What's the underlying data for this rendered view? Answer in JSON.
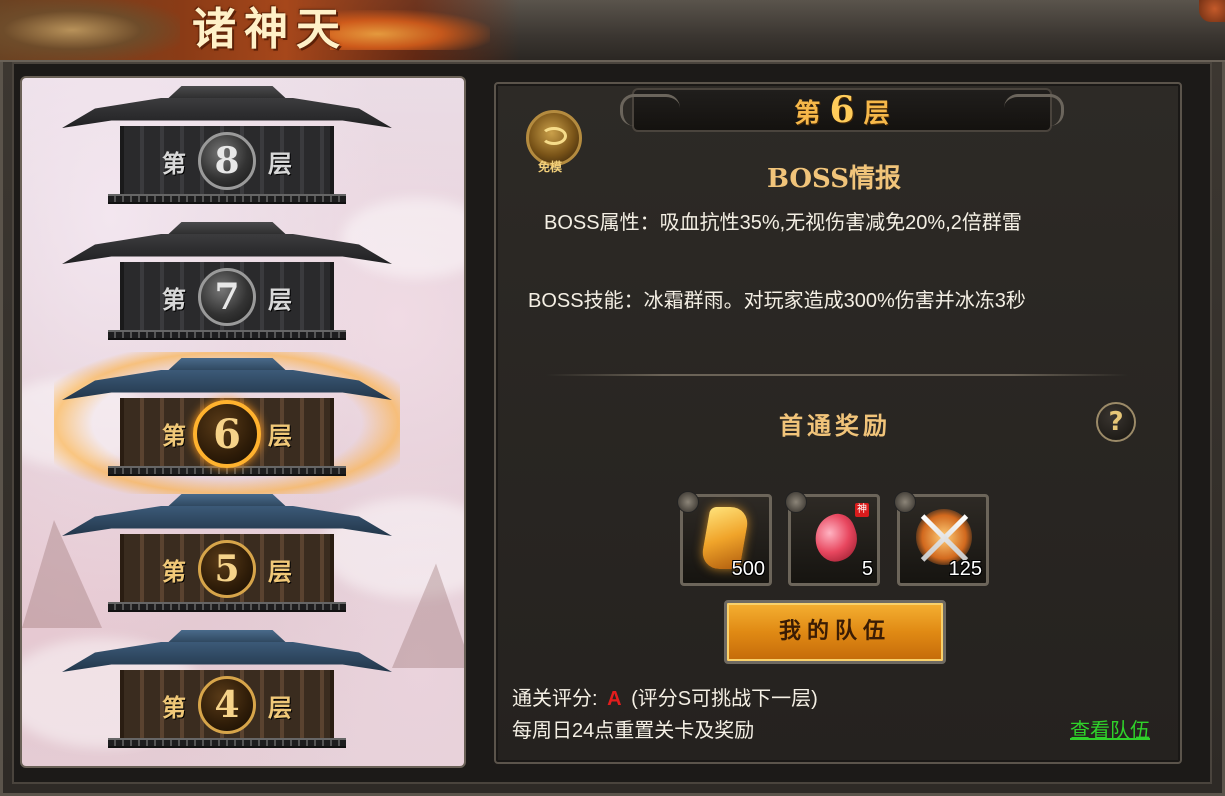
{
  "header": {
    "title": "诸神天"
  },
  "tower": {
    "floors": [
      {
        "num": "8",
        "prefix": "第",
        "suffix": "层",
        "state": "locked"
      },
      {
        "num": "7",
        "prefix": "第",
        "suffix": "层",
        "state": "locked"
      },
      {
        "num": "6",
        "prefix": "第",
        "suffix": "层",
        "state": "current"
      },
      {
        "num": "5",
        "prefix": "第",
        "suffix": "层",
        "state": "cleared"
      },
      {
        "num": "4",
        "prefix": "第",
        "suffix": "层",
        "state": "cleared"
      }
    ]
  },
  "detail": {
    "floor_prefix": "第",
    "floor_num": "6",
    "floor_suffix": "层",
    "logo_label": "免模",
    "boss_title": "BOSS情报",
    "boss_attr": "BOSS属性：吸血抗性35%,无视伤害减免20%,2倍群雷",
    "boss_skill": "BOSS技能：冰霜群雨。对玩家造成300%伤害并冰冻3秒",
    "reward_title": "首通奖励",
    "help_glyph": "?",
    "rewards": [
      {
        "icon": "gold-scroll-icon",
        "qty": "500"
      },
      {
        "icon": "red-gem-icon",
        "qty": "5",
        "tag": "神"
      },
      {
        "icon": "crossed-swords-icon",
        "qty": "125"
      }
    ],
    "team_button": "我的队伍",
    "rating_label": "通关评分:",
    "rating_grade": "A",
    "rating_note": "(评分S可挑战下一层)",
    "reset_note": "每周日24点重置关卡及奖励",
    "view_team_link": "查看队伍"
  },
  "colors": {
    "accent_gold": "#f1c47a",
    "grade_red": "#e21d1d",
    "link_green": "#2fd12a",
    "button_orange": "#e08a14"
  }
}
